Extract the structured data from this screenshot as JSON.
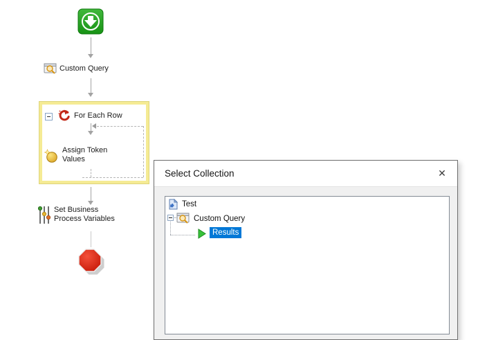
{
  "workflow": {
    "nodes": {
      "start": {
        "icon": "start-icon"
      },
      "custom_query": {
        "label": "Custom Query",
        "icon": "query-icon"
      },
      "for_each_row": {
        "label": "For Each Row",
        "icon": "loop-icon",
        "highlighted": true
      },
      "assign_token": {
        "lines": [
          "Assign Token",
          "Values"
        ],
        "icon": "token-coin-icon"
      },
      "set_bpv": {
        "lines": [
          "Set Business",
          "Process Variables"
        ],
        "icon": "sliders-icon"
      },
      "stop": {
        "icon": "stop-icon"
      }
    },
    "colors": {
      "start_green": "#1f9c1c",
      "stop_red": "#d62a18",
      "highlight_yellow": "#f5eb94",
      "connector_gray": "#a3a3a3"
    }
  },
  "dialog": {
    "title": "Select Collection",
    "close_glyph": "✕",
    "tree": {
      "items": [
        {
          "label": "Test",
          "icon": "workflow-file-icon",
          "level": 0,
          "selected": false
        },
        {
          "label": "Custom Query",
          "icon": "query-icon",
          "level": 1,
          "selected": false,
          "expander": "minus"
        },
        {
          "label": "Results",
          "icon": "play-icon",
          "level": 2,
          "selected": true
        }
      ],
      "selection_color": "#0078d7"
    }
  }
}
